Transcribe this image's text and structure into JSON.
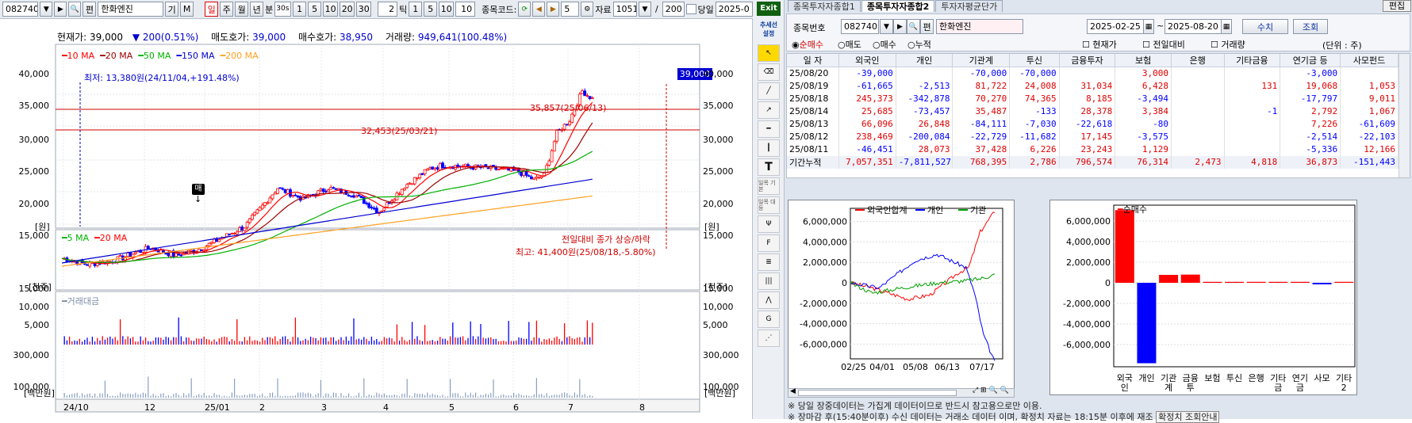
{
  "toolbar": {
    "code": "082740",
    "pen": "편",
    "name": "한화엔진",
    "ki": "기",
    "m": "M",
    "periods": [
      "일",
      "주",
      "월",
      "년",
      "분"
    ],
    "sel_period": "일",
    "min_box": "30s",
    "nums": [
      "1",
      "5",
      "10",
      "20",
      "30"
    ],
    "tick_val": "2",
    "tick_label": "틱",
    "tick_nums": [
      "1",
      "5",
      "10"
    ],
    "tick_last": "10",
    "code_label": "종목코드:",
    "page_val": "5",
    "jaryo": "자료",
    "jaryo_val": "1051",
    "slash": "/",
    "count": "200",
    "dangil": "당일",
    "date": "2025-0"
  },
  "rb": {
    "exit": "Exit",
    "trend": "추세선 설정",
    "ilmok1": "일목 기본",
    "ilmok2": "일목 대등"
  },
  "info": {
    "cur_label": "현재가:",
    "cur": "39,000",
    "chg": "200(0.51%)",
    "ask_label": "매도호가:",
    "ask": "39,000",
    "bid_label": "매수호가:",
    "bid": "38,950",
    "vol_label": "거래량:",
    "vol": "949,641(100.48%)"
  },
  "legend": {
    "ma10": "10 MA",
    "ma20": "20 MA",
    "ma50": "50 MA",
    "ma150": "150 MA",
    "ma200": "200 MA",
    "vma5": "5 MA",
    "vma20": "20 MA",
    "amt": "거래대금"
  },
  "colors": {
    "ma10": "#ff0000",
    "ma20": "#a00000",
    "ma50": "#00b000",
    "ma150": "#0000d0",
    "ma200": "#ffa020",
    "up": "#ff0000",
    "down": "#0000ff"
  },
  "ann": {
    "low": "최저: 13,380원(24/11/04,+191.48%)",
    "h1": "35,857(25/06/13)",
    "h2": "32,453(25/03/21)",
    "high": "최고: 41,400원(25/08/18,-5.80%)",
    "buy": "매",
    "vol_note": "전일대비 종가 상승/하락",
    "cur_price": "39,000"
  },
  "axes": {
    "price": [
      "40,000",
      "35,000",
      "30,000",
      "25,000",
      "20,000",
      "15,000"
    ],
    "price_unit": "[원]",
    "vol": [
      "15,000",
      "10,000",
      "5,000"
    ],
    "vol_unit": "[천주]",
    "amt": [
      "300,000",
      "100,000"
    ],
    "amt_unit": "[백만원]",
    "dates": [
      "24/10",
      "12",
      "25/01",
      "2",
      "3",
      "4",
      "5",
      "6",
      "7",
      "8"
    ]
  },
  "tabs": [
    "종목투자자종합1",
    "종목투자자종합2",
    "투자자평균단가"
  ],
  "tabs_right": "편집",
  "filter": {
    "code_label": "종목번호",
    "code": "082740",
    "pen": "편",
    "name": "한화엔진",
    "from": "2025-02-25",
    "to": "2025-08-20",
    "btn1": "수치",
    "btn2": "조회",
    "radios": [
      "순매수",
      "매도",
      "매수",
      "누적"
    ],
    "checks": [
      "현재가",
      "전일대비",
      "거래량"
    ],
    "unit": "(단위 : 주)"
  },
  "table": {
    "headers": [
      "일 자",
      "외국인",
      "개인",
      "기관계",
      "투신",
      "금융투자",
      "보험",
      "은행",
      "기타금융",
      "연기금 등",
      "사모펀드"
    ],
    "rows": [
      [
        "25/08/20",
        "-39,000",
        "",
        "-70,000",
        "-70,000",
        "",
        "3,000",
        "",
        "",
        "-3,000",
        ""
      ],
      [
        "25/08/19",
        "-61,665",
        "-2,513",
        "81,722",
        "24,008",
        "31,034",
        "6,428",
        "",
        "131",
        "19,068",
        "1,053"
      ],
      [
        "25/08/18",
        "245,373",
        "-342,878",
        "70,270",
        "74,365",
        "8,185",
        "-3,494",
        "",
        "",
        "-17,797",
        "9,011"
      ],
      [
        "25/08/14",
        "25,685",
        "-73,457",
        "35,487",
        "-133",
        "28,378",
        "3,384",
        "",
        "-1",
        "2,792",
        "1,067"
      ],
      [
        "25/08/13",
        "66,096",
        "26,848",
        "-84,111",
        "-7,030",
        "-22,618",
        "-80",
        "",
        "",
        "7,226",
        "-61,609"
      ],
      [
        "25/08/12",
        "238,469",
        "-200,084",
        "-22,729",
        "-11,682",
        "17,145",
        "-3,575",
        "",
        "",
        "-2,514",
        "-22,103"
      ],
      [
        "25/08/11",
        "-46,451",
        "28,073",
        "37,428",
        "6,226",
        "23,243",
        "1,129",
        "",
        "",
        "-5,336",
        "12,166"
      ],
      [
        "기간누적",
        "7,057,351",
        "-7,811,527",
        "768,395",
        "2,786",
        "796,574",
        "76,314",
        "2,473",
        "4,818",
        "36,873",
        "-151,443"
      ]
    ]
  },
  "linechart": {
    "legend": [
      "외국인합계",
      "개인",
      "기관"
    ],
    "yticks": [
      "6,000,000",
      "4,000,000",
      "2,000,000",
      "0",
      "-2,000,000",
      "-4,000,000",
      "-6,000,000"
    ],
    "xticks": [
      "02/25",
      "04/01",
      "05/08",
      "06/13",
      "07/17"
    ]
  },
  "barchart": {
    "legend": "순매수",
    "yticks": [
      "6,000,000",
      "4,000,000",
      "2,000,000",
      "0",
      "-2,000,000",
      "-4,000,000",
      "-6,000,000"
    ],
    "cats": [
      "외국인",
      "개인",
      "기관계",
      "금융투",
      "보험",
      "투신",
      "은행",
      "기타금",
      "연기금",
      "사모",
      "기타2"
    ],
    "values": [
      7057351,
      -7811527,
      768395,
      796574,
      76314,
      2786,
      2473,
      4818,
      36873,
      -151443,
      0
    ],
    "colors": [
      "#ff0000",
      "#0000ff",
      "#ff0000",
      "#ff0000",
      "#ff0000",
      "#ff0000",
      "#ff0000",
      "#ff0000",
      "#ff0000",
      "#0000ff",
      "#ff0000"
    ]
  },
  "notes": [
    "※ 당일 장중데이터는 가집계 데이터이므로 반드시 참고용으로만 이용.",
    "※ 장마감 후(15:40분이후) 수신 데이터는 거래소 데이터 이며, 확정치 자료는 18:15분 이후에 재조"
  ],
  "note_btn": "확정치 조회안내"
}
